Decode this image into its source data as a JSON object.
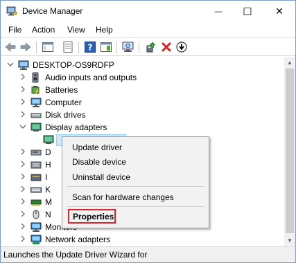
{
  "window": {
    "title": "Device Manager",
    "minimize_glyph": "—",
    "maximize_glyph": "☐",
    "close_glyph": "✕"
  },
  "menu": [
    "File",
    "Action",
    "View",
    "Help"
  ],
  "toolbar": {
    "icons": [
      "back-icon",
      "forward-icon",
      "console-tree-icon",
      "properties-icon",
      "help-icon",
      "action-pane-icon",
      "scan-hardware-icon",
      "update-driver-icon",
      "uninstall-icon",
      "enable-device-icon"
    ]
  },
  "tree": {
    "root": "DESKTOP-OS9RDFP",
    "items": [
      {
        "label": "Audio inputs and outputs",
        "icon": "speaker-icon",
        "expander": ">"
      },
      {
        "label": "Batteries",
        "icon": "battery-icon",
        "expander": ">"
      },
      {
        "label": "Computer",
        "icon": "computer-icon",
        "expander": ">"
      },
      {
        "label": "Disk drives",
        "icon": "disk-drive-icon",
        "expander": ">"
      },
      {
        "label": "Display adapters",
        "icon": "display-adapter-icon",
        "expander": "v"
      }
    ],
    "partial_rows": [
      "D",
      "H",
      "I",
      "K",
      "M",
      "N"
    ],
    "lower_items": [
      {
        "label": "Monitors",
        "icon": "monitor-icon",
        "expander": ">"
      },
      {
        "label": "Network adapters",
        "icon": "network-adapter-icon",
        "expander": ">"
      }
    ]
  },
  "context_menu": {
    "items": [
      "Update driver",
      "Disable device",
      "Uninstall device"
    ],
    "scan": "Scan for hardware changes",
    "properties": "Properties"
  },
  "status": "Launches the Update Driver Wizard for",
  "colors": {
    "highlight_red": "#e0242a",
    "toolbar_red_x": "#d81e1e",
    "help_blue": "#2b5fb4",
    "monitor_blue": "#1e7fd2"
  }
}
